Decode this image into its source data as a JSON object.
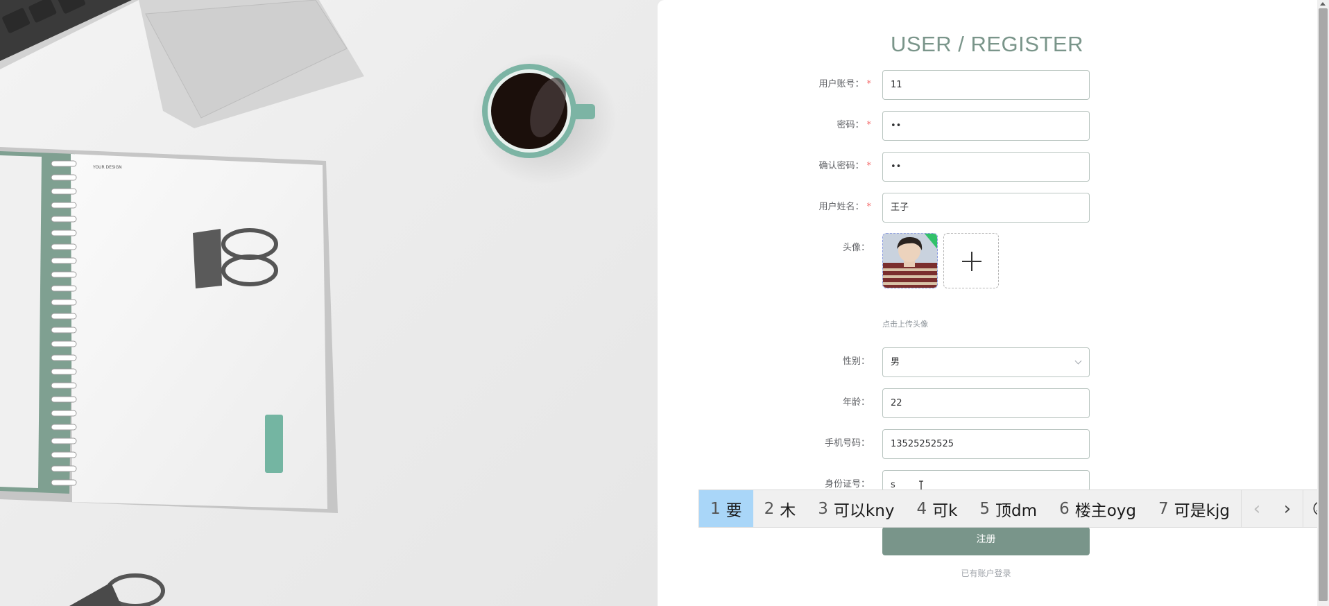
{
  "page": {
    "title": "USER / REGISTER"
  },
  "form": {
    "username": {
      "label": "用户账号：",
      "required": true,
      "value": "11"
    },
    "password": {
      "label": "密码：",
      "required": true,
      "value": "••"
    },
    "confirm_password": {
      "label": "确认密码：",
      "required": true,
      "value": "••"
    },
    "real_name": {
      "label": "用户姓名：",
      "required": true,
      "value": "王子"
    },
    "avatar": {
      "label": "头像：",
      "upload_tip": "点击上传头像",
      "add_icon": "plus-icon"
    },
    "gender": {
      "label": "性别：",
      "value": "男",
      "icon": "chevron-down-icon"
    },
    "age": {
      "label": "年龄：",
      "value": "22"
    },
    "phone": {
      "label": "手机号码：",
      "value": "13525252525"
    },
    "id_card": {
      "label": "身份证号：",
      "value": "s"
    },
    "submit_label": "注册",
    "login_link": "已有账户登录"
  },
  "ime": {
    "candidates": [
      {
        "num": "1",
        "text": "要",
        "selected": true
      },
      {
        "num": "2",
        "text": "木",
        "selected": false
      },
      {
        "num": "3",
        "text": "可以kny",
        "selected": false
      },
      {
        "num": "4",
        "text": "可k",
        "selected": false
      },
      {
        "num": "5",
        "text": "顶dm",
        "selected": false
      },
      {
        "num": "6",
        "text": "楼主oyg",
        "selected": false
      },
      {
        "num": "7",
        "text": "可是kjg",
        "selected": false
      }
    ],
    "prev_glyph": "‹",
    "next_glyph": "›",
    "emoji_glyph": "☺"
  },
  "colors": {
    "accent": "#79958a",
    "title": "#7a958a",
    "required": "#f56c6c",
    "ime_selected": "#a9d6f8"
  }
}
